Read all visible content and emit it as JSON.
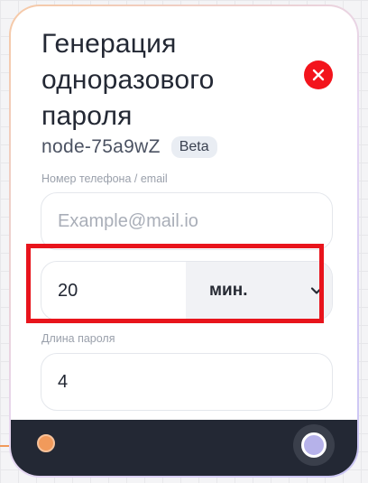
{
  "node": {
    "title": "Генерация одноразового пароля",
    "node_id": "node-75a9wZ",
    "badge": "Beta"
  },
  "fields": {
    "contact_label": "Номер телефона / email",
    "contact_placeholder": "Example@mail.io",
    "duration_value": "20",
    "duration_unit": "мин.",
    "length_label": "Длина пароля",
    "length_value": "4"
  },
  "icons": {
    "close": "close-icon",
    "dropdown": "chevron-down-icon",
    "input_port": "input-port-icon",
    "output_port": "output-port-icon"
  },
  "colors": {
    "close": "#f3141c",
    "highlight": "#e8141c",
    "footer": "#232834",
    "input_port": "#f19a5b",
    "output_port": "#b6b2ea"
  }
}
